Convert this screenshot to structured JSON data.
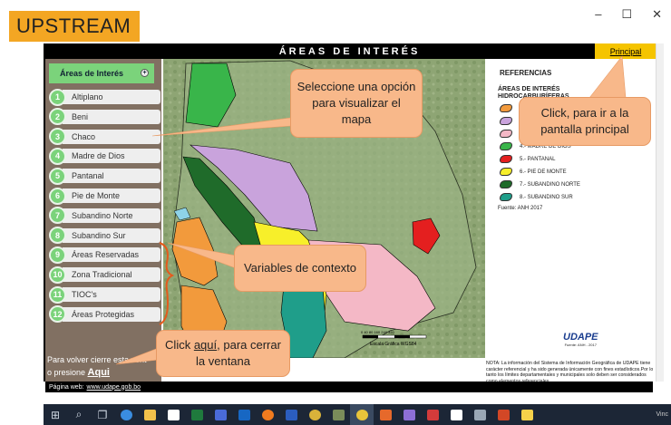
{
  "upstream_label": "UPSTREAM",
  "window": {
    "minimize": "–",
    "maximize": "☐",
    "close": "✕"
  },
  "app": {
    "title": "ÁREAS DE INTERÉS",
    "principal_label": "Principal"
  },
  "sidebar": {
    "header": "Áreas de Interés",
    "items": [
      {
        "num": "1",
        "label": "Altiplano"
      },
      {
        "num": "2",
        "label": "Beni"
      },
      {
        "num": "3",
        "label": "Chaco"
      },
      {
        "num": "4",
        "label": "Madre de Dios"
      },
      {
        "num": "5",
        "label": "Pantanal"
      },
      {
        "num": "6",
        "label": "Pie de Monte"
      },
      {
        "num": "7",
        "label": "Subandino Norte"
      },
      {
        "num": "8",
        "label": "Subandino Sur"
      },
      {
        "num": "9",
        "label": "Áreas Reservadas"
      },
      {
        "num": "10",
        "label": "Zona Tradicional"
      },
      {
        "num": "11",
        "label": "TIOC's"
      },
      {
        "num": "12",
        "label": "Áreas Protegidas"
      }
    ],
    "volver_line1": "Para volver cierre esta vent",
    "volver_line2": "o presione",
    "volver_link": "Aqui"
  },
  "references": {
    "title": "REFERENCIAS",
    "subtitle": "ÁREAS DE INTERÉS",
    "subtitle2": "HIDROCARBURÍFERAS",
    "items": [
      {
        "label": "",
        "color": "#f29a3c"
      },
      {
        "label": "",
        "color": "#c9a3dc"
      },
      {
        "label": "",
        "color": "#f4b8c6"
      },
      {
        "label": "4.- MADRE DE DIOS",
        "color": "#39b54a"
      },
      {
        "label": "5.- PANTANAL",
        "color": "#e41f1f"
      },
      {
        "label": "6.- PIE DE MONTE",
        "color": "#f7ef2a"
      },
      {
        "label": "7.- SUBANDINO NORTE",
        "color": "#1f6b2a"
      },
      {
        "label": "8.- SUBANDINO SUR",
        "color": "#1f9e8a"
      }
    ],
    "source": "Fuente: ANH 2017",
    "logo_text": "UDAPE",
    "logo_source": "Fuente: ANH - 2017"
  },
  "map": {
    "scale_label": "Escala Gráfica  WGS84",
    "scale_ticks": "0  40  80   160   240   320"
  },
  "note": "NOTA: La información del Sistema de Información Geográfica de UDAPE tiene carácter referencial y ha sido generada únicamente con fines estadísticos.Por lo tanto los límites departamentales y municipales solo deben ser considerados como elementos referenciales.",
  "footer": {
    "label": "Página web:",
    "link": "www.udape.gob.bo"
  },
  "callouts": {
    "seleccione": "Seleccione una opción para visualizar el mapa",
    "principal": "Click, para ir a la pantalla principal",
    "variables": "Variables de contexto",
    "click_pre": "Click ",
    "click_link": "aquí",
    "click_post": ", para cerrar la ventana"
  },
  "taskbar": {
    "vinc": "Vinc"
  }
}
